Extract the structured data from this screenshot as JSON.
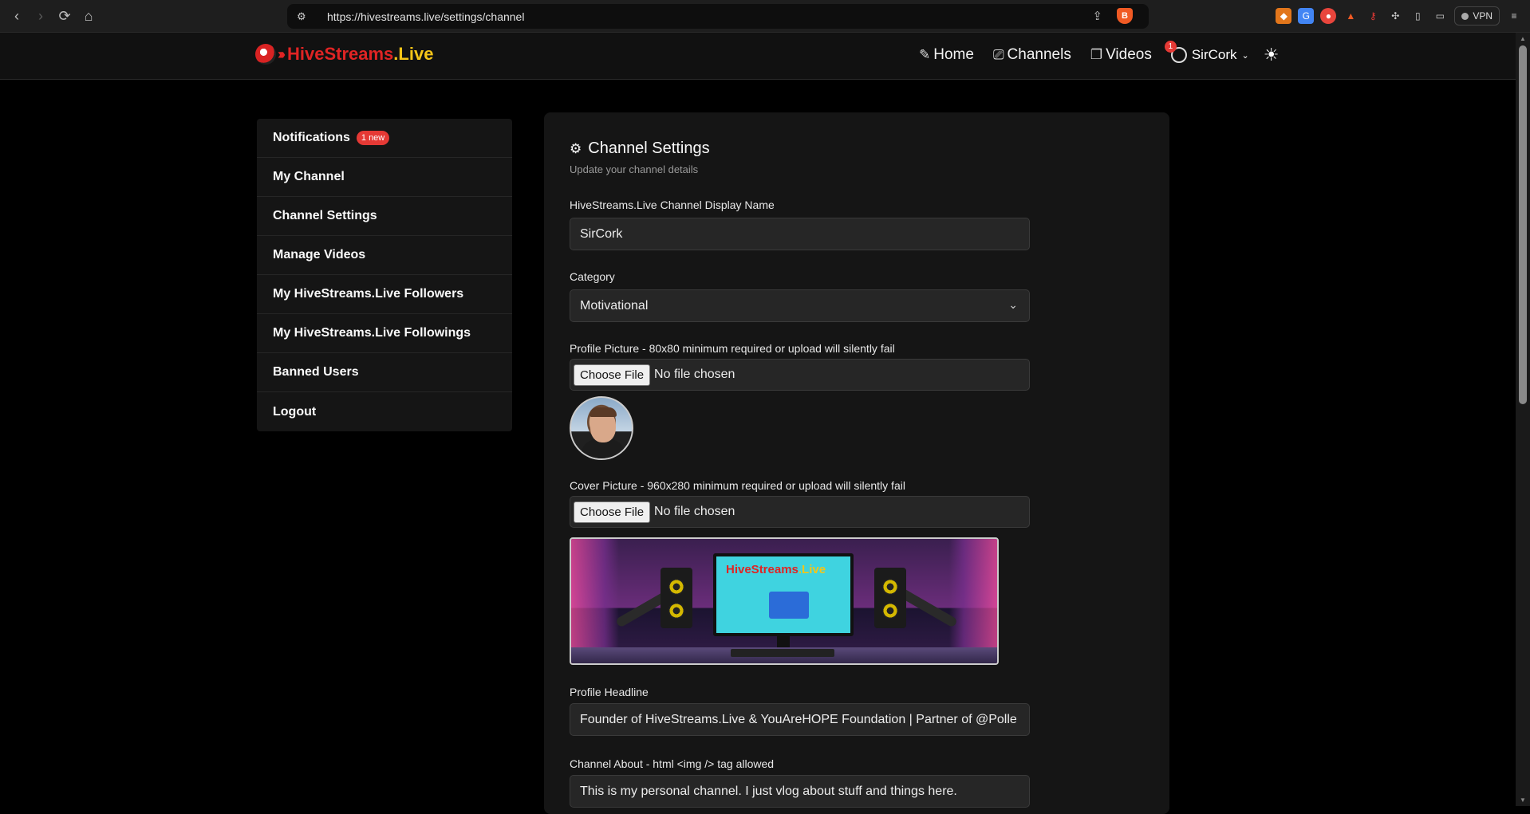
{
  "browser": {
    "url": "https://hivestreams.live/settings/channel",
    "vpn_label": "VPN"
  },
  "header": {
    "logo_main": "HiveStreams",
    "logo_tld": ".Live",
    "nav": [
      {
        "label": "Home",
        "icon": "edit-square-icon"
      },
      {
        "label": "Channels",
        "icon": "cast-icon"
      },
      {
        "label": "Videos",
        "icon": "collection-icon"
      }
    ],
    "user": {
      "name": "SirCork",
      "badge": "1"
    }
  },
  "sidebar": {
    "items": [
      {
        "label": "Notifications",
        "badge": "1 new"
      },
      {
        "label": "My Channel"
      },
      {
        "label": "Channel Settings"
      },
      {
        "label": "Manage Videos"
      },
      {
        "label": "My HiveStreams.Live Followers"
      },
      {
        "label": "My HiveStreams.Live Followings"
      },
      {
        "label": "Banned Users"
      },
      {
        "label": "Logout"
      }
    ]
  },
  "form": {
    "title": "Channel Settings",
    "subtitle": "Update your channel details",
    "display_name_label": "HiveStreams.Live Channel Display Name",
    "display_name_value": "SirCork",
    "category_label": "Category",
    "category_value": "Motivational",
    "profile_picture_label": "Profile Picture - 80x80 minimum required or upload will silently fail",
    "cover_picture_label": "Cover Picture - 960x280 minimum required or upload will silently fail",
    "choose_file_label": "Choose File",
    "no_file_label": "No file chosen",
    "cover_logo_main": "HiveStreams",
    "cover_logo_tld": ".Live",
    "headline_label": "Profile Headline",
    "headline_value": "Founder of HiveStreams.Live & YouAreHOPE Foundation | Partner of @Polle",
    "about_label": "Channel About - html <img /> tag allowed",
    "about_value": "This is my personal channel. I just vlog about stuff and things here."
  },
  "colors": {
    "brand_red": "#e02424",
    "brand_yellow": "#f5c518",
    "badge_red": "#e53935"
  }
}
